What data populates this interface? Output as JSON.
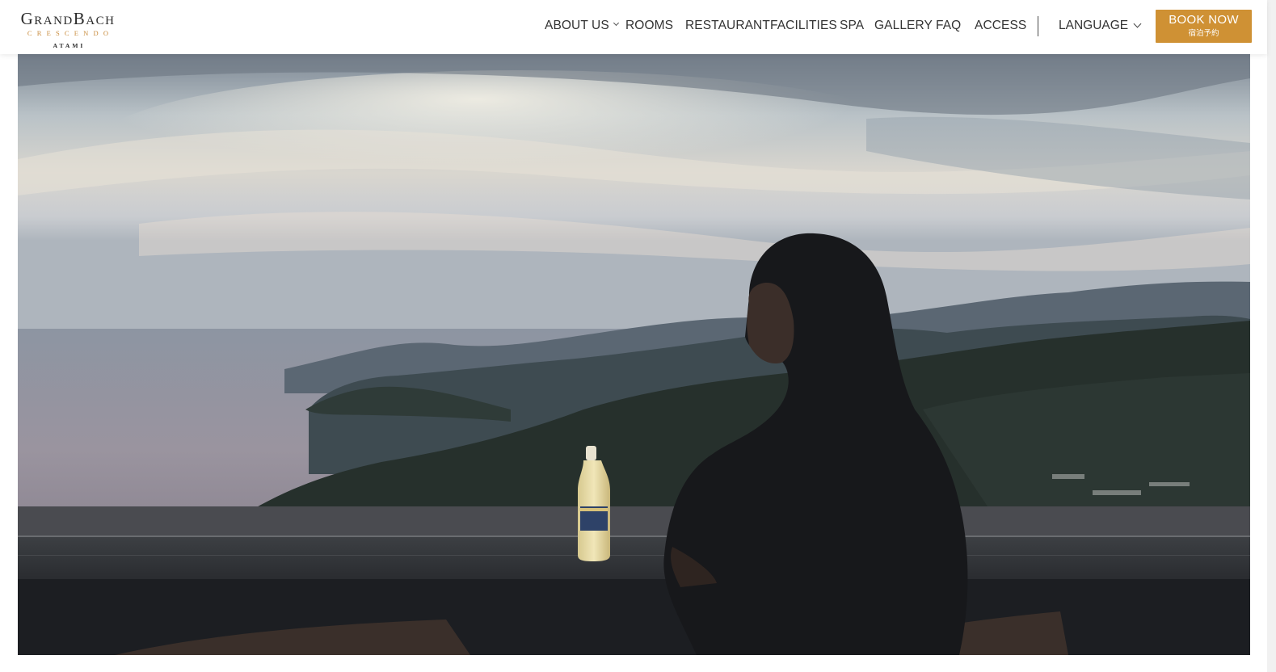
{
  "brand": {
    "name": "GrandBach",
    "subtitle": "CRESCENDO",
    "city": "ATAMI",
    "accent_color": "#cf9134"
  },
  "nav": {
    "items": [
      {
        "label": "ABOUT US",
        "has_dropdown": true
      },
      {
        "label": "ROOMS",
        "has_dropdown": false
      },
      {
        "label": "RESTAURANT",
        "has_dropdown": false
      },
      {
        "label": "FACILITIES",
        "has_dropdown": false
      },
      {
        "label": "SPA",
        "has_dropdown": false
      },
      {
        "label": "GALLERY",
        "has_dropdown": false
      },
      {
        "label": "FAQ",
        "has_dropdown": false
      },
      {
        "label": "ACCESS",
        "has_dropdown": false
      }
    ],
    "language_label": "LANGUAGE",
    "language_icon": "chevron-down-icon"
  },
  "book": {
    "label": "BOOK NOW",
    "sublabel": "宿泊予約"
  }
}
